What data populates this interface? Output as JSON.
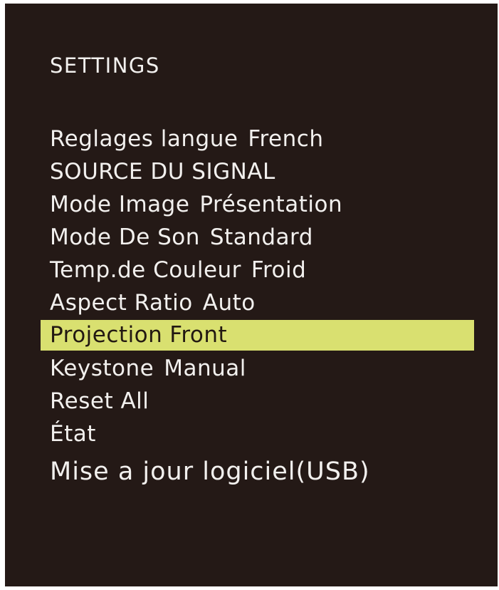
{
  "title": "SETTINGS",
  "colors": {
    "background": "#241916",
    "text": "#f2f0ee",
    "highlight": "#d9e070",
    "highlight_text": "#221812"
  },
  "menu": [
    {
      "label": "Reglages langue",
      "value": "French",
      "selected": false
    },
    {
      "label": "SOURCE DU SIGNAL",
      "value": "",
      "selected": false
    },
    {
      "label": "Mode Image",
      "value": "Présentation",
      "selected": false
    },
    {
      "label": "Mode De Son",
      "value": "Standard",
      "selected": false
    },
    {
      "label": "Temp.de Couleur",
      "value": "Froid",
      "selected": false
    },
    {
      "label": "Aspect Ratio",
      "value": "Auto",
      "selected": false
    },
    {
      "label": "Projection",
      "value": "Front",
      "selected": true
    },
    {
      "label": "Keystone",
      "value": "Manual",
      "selected": false
    },
    {
      "label": "Reset All",
      "value": "",
      "selected": false
    },
    {
      "label": "État",
      "value": "",
      "selected": false
    },
    {
      "label": "Mise a jour logiciel(USB)",
      "value": "",
      "selected": false
    }
  ]
}
